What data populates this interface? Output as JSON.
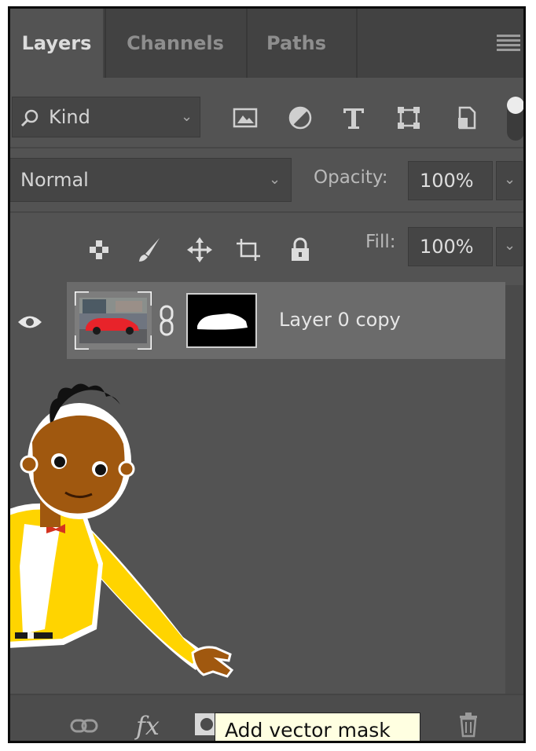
{
  "tabs": [
    "Layers",
    "Channels",
    "Paths"
  ],
  "filter": {
    "label": "Kind"
  },
  "blend": {
    "mode": "Normal",
    "opacity_label": "Opacity:",
    "opacity_value": "100%"
  },
  "fill": {
    "label": "Fill:",
    "value": "100%"
  },
  "layer": {
    "name": "Layer 0 copy"
  },
  "tooltip": "Add vector mask",
  "colors": {
    "panel": "#535353",
    "tab_inactive": "#424242",
    "selected_row": "#6b6b6b",
    "tooltip_bg": "#ffffe1"
  }
}
